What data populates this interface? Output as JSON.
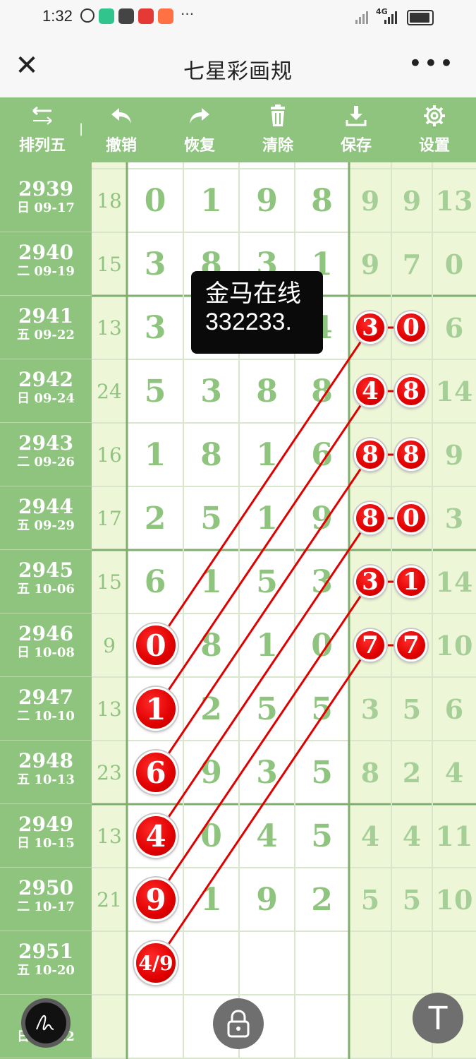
{
  "status_bar": {
    "time": "1:32",
    "network_label": "4G",
    "more_dots": "···",
    "app_icon_colors": [
      "#31c48d",
      "#444444",
      "#e53935",
      "#ff7043"
    ]
  },
  "title_bar": {
    "close_glyph": "✕",
    "title": "七星彩画规",
    "more_glyph": "•••"
  },
  "toolbar": {
    "items": [
      {
        "label": "排列五",
        "icon": "swap-arrows-icon"
      },
      {
        "label": "撤销",
        "icon": "undo-icon"
      },
      {
        "label": "恢复",
        "icon": "redo-icon"
      },
      {
        "label": "清除",
        "icon": "trash-icon"
      },
      {
        "label": "保存",
        "icon": "download-icon"
      },
      {
        "label": "设置",
        "icon": "gear-icon"
      }
    ],
    "divider": "|"
  },
  "colors": {
    "accent_green": "#8fc47f",
    "light_green": "#eef6d8",
    "ball_red": "#e00000"
  },
  "rows": [
    {
      "period": "2939",
      "date": "日 09-17",
      "sum": "18",
      "digits": [
        "0",
        "1",
        "9",
        "8"
      ],
      "right": [
        "9",
        "9",
        "13"
      ]
    },
    {
      "period": "2940",
      "date": "二 09-19",
      "sum": "15",
      "digits": [
        "3",
        "8",
        "3",
        "1"
      ],
      "right": [
        "9",
        "7",
        "0"
      ]
    },
    {
      "period": "2941",
      "date": "五 09-22",
      "sum": "13",
      "digits": [
        "3",
        "",
        "",
        "4"
      ],
      "right": [
        "3",
        "0",
        "6"
      ],
      "right_balls": [
        true,
        true
      ]
    },
    {
      "period": "2942",
      "date": "日 09-24",
      "sum": "24",
      "digits": [
        "5",
        "3",
        "8",
        "8"
      ],
      "right": [
        "4",
        "8",
        "14"
      ],
      "right_balls": [
        true,
        true
      ]
    },
    {
      "period": "2943",
      "date": "二 09-26",
      "sum": "16",
      "digits": [
        "1",
        "8",
        "1",
        "6"
      ],
      "right": [
        "8",
        "8",
        "9"
      ],
      "right_balls": [
        true,
        true
      ]
    },
    {
      "period": "2944",
      "date": "五 09-29",
      "sum": "17",
      "digits": [
        "2",
        "5",
        "1",
        "9"
      ],
      "right": [
        "8",
        "0",
        "3"
      ],
      "right_balls": [
        true,
        true
      ]
    },
    {
      "period": "2945",
      "date": "五 10-06",
      "sum": "15",
      "digits": [
        "6",
        "1",
        "5",
        "3"
      ],
      "right": [
        "3",
        "1",
        "14"
      ],
      "right_balls": [
        true,
        true
      ]
    },
    {
      "period": "2946",
      "date": "日 10-08",
      "sum": "9",
      "digits": [
        "0",
        "8",
        "1",
        "0"
      ],
      "right": [
        "7",
        "7",
        "10"
      ],
      "right_balls": [
        true,
        true
      ],
      "first_ball": true
    },
    {
      "period": "2947",
      "date": "二 10-10",
      "sum": "13",
      "digits": [
        "1",
        "2",
        "5",
        "5"
      ],
      "right": [
        "3",
        "5",
        "6"
      ],
      "first_ball": true
    },
    {
      "period": "2948",
      "date": "五 10-13",
      "sum": "23",
      "digits": [
        "6",
        "9",
        "3",
        "5"
      ],
      "right": [
        "8",
        "2",
        "4"
      ],
      "first_ball": true
    },
    {
      "period": "2949",
      "date": "日 10-15",
      "sum": "13",
      "digits": [
        "4",
        "0",
        "4",
        "5"
      ],
      "right": [
        "4",
        "4",
        "11"
      ],
      "first_ball": true
    },
    {
      "period": "2950",
      "date": "二 10-17",
      "sum": "21",
      "digits": [
        "9",
        "1",
        "9",
        "2"
      ],
      "right": [
        "5",
        "5",
        "10"
      ],
      "first_ball": true
    },
    {
      "period": "2951",
      "date": "五 10-20",
      "sum": "",
      "digits": [
        "4/9",
        "",
        "",
        ""
      ],
      "right": [
        "",
        "",
        ""
      ],
      "first_ball": true
    }
  ],
  "partial_row": {
    "date": "日 10-22"
  },
  "tooltip": {
    "line1": "金马在线",
    "line2": "332233."
  },
  "fabs": {
    "lock": "lock-icon",
    "pen": "signature-icon",
    "top_glyph": "T"
  }
}
